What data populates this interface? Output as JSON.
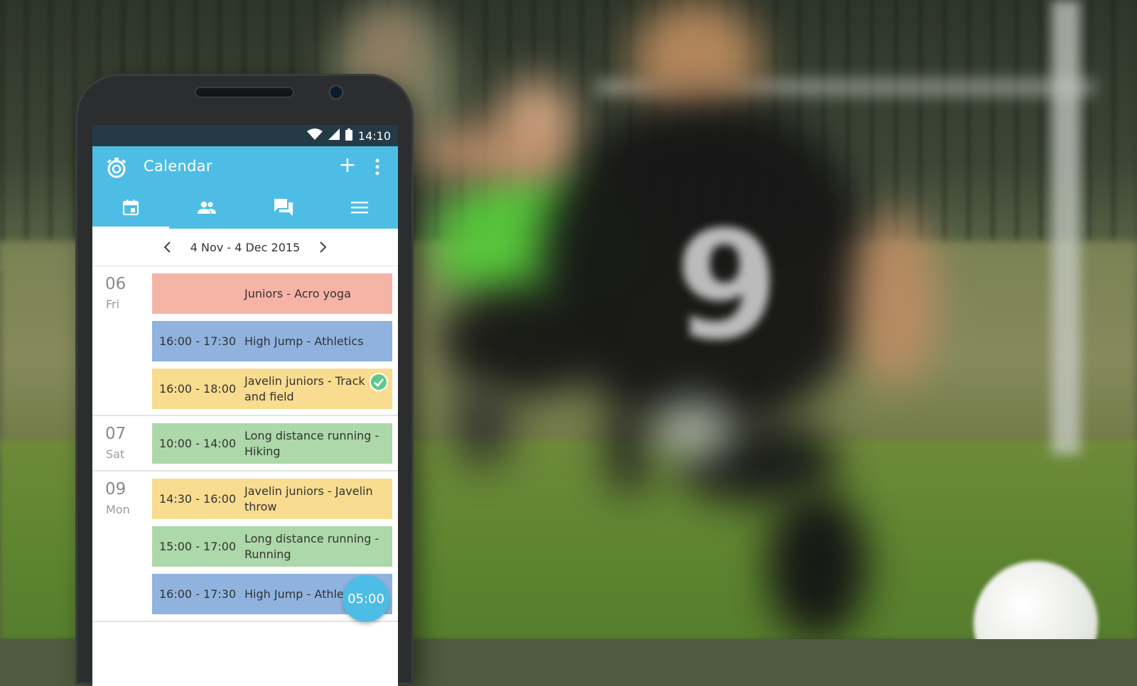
{
  "status_bar": {
    "time": "14:10",
    "icons": [
      "wifi-icon",
      "signal-icon",
      "battery-icon"
    ]
  },
  "app_bar": {
    "title": "Calendar",
    "add_label": "+",
    "menu_icon": "more-vert-icon",
    "logo_icon": "stopwatch-icon"
  },
  "tabs": [
    {
      "icon": "calendar-icon",
      "active": true
    },
    {
      "icon": "people-icon",
      "active": false
    },
    {
      "icon": "chat-icon",
      "active": false
    },
    {
      "icon": "menu-icon",
      "active": false
    }
  ],
  "date_range": {
    "label": "4 Nov - 4 Dec 2015"
  },
  "days": [
    {
      "num": "06",
      "name": "Fri",
      "events": [
        {
          "time": "",
          "title": "Juniors - Acro yoga",
          "color": "#f5b4a6"
        },
        {
          "time": "16:00 - 17:30",
          "title": "High Jump - Athletics",
          "color": "#8fb3de"
        },
        {
          "time": "16:00 - 18:00",
          "title": "Javelin juniors - Track and field",
          "color": "#f8dc8f",
          "checked": true
        }
      ]
    },
    {
      "num": "07",
      "name": "Sat",
      "events": [
        {
          "time": "10:00 - 14:00",
          "title": "Long distance running - Hiking",
          "color": "#add8a9"
        }
      ]
    },
    {
      "num": "09",
      "name": "Mon",
      "events": [
        {
          "time": "14:30 - 16:00",
          "title": "Javelin juniors - Javelin throw",
          "color": "#f8dc8f"
        },
        {
          "time": "15:00 - 17:00",
          "title": "Long distance running - Running",
          "color": "#add8a9"
        },
        {
          "time": "16:00 - 17:30",
          "title": "High Jump - Athlet",
          "color": "#8fb3de"
        }
      ]
    }
  ],
  "timer": {
    "label": "05:00"
  },
  "colors": {
    "accent": "#4dbde6",
    "status_bar": "#243a47",
    "check": "#5cc98a"
  }
}
